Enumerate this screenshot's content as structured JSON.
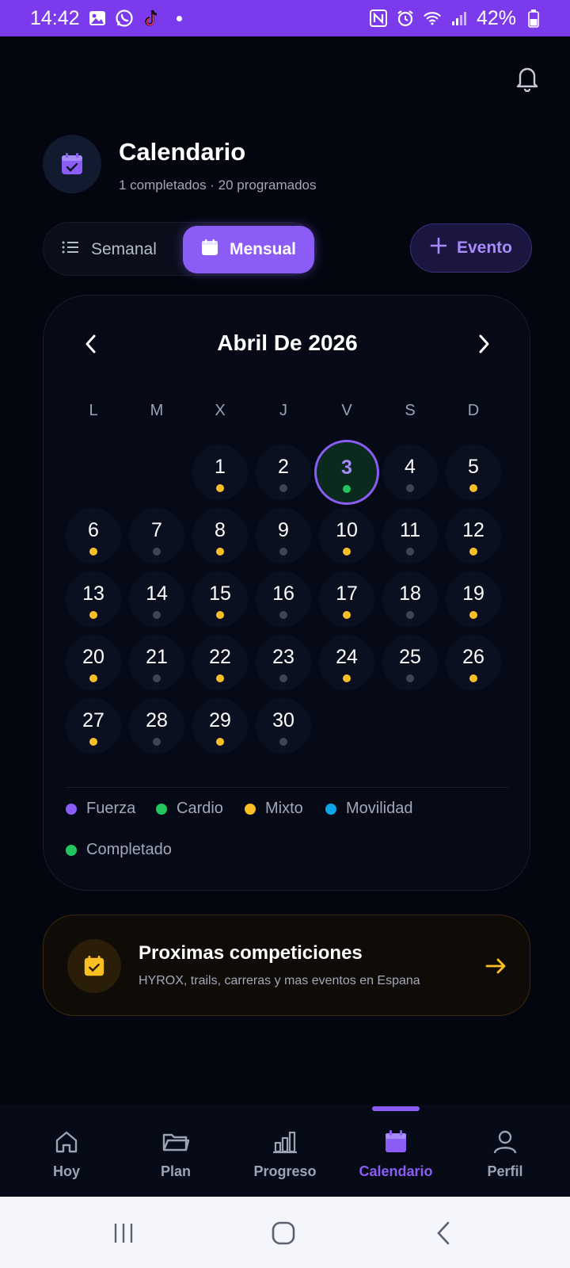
{
  "status_bar": {
    "time": "14:42",
    "battery": "42%",
    "icons_left": [
      "gallery-icon",
      "whatsapp-icon",
      "tiktok-icon",
      "dot-icon"
    ],
    "icons_right": [
      "nfc-icon",
      "alarm-icon",
      "wifi-icon",
      "signal-icon",
      "battery-icon"
    ],
    "bar_color": "#7c3aed"
  },
  "header": {
    "title": "Calendario",
    "subtitle": "1 completados · 20 programados"
  },
  "view_toggle": {
    "weekly_label": "Semanal",
    "monthly_label": "Mensual",
    "selected": "Mensual"
  },
  "add_event": {
    "label": "Evento"
  },
  "calendar": {
    "month_title": "Abril De 2026",
    "weekdays": [
      "L",
      "M",
      "X",
      "J",
      "V",
      "S",
      "D"
    ],
    "first_weekday_index": 2,
    "today": 3,
    "days": [
      {
        "num": "1",
        "dot": "mixto"
      },
      {
        "num": "2",
        "dot": "none"
      },
      {
        "num": "3",
        "dot": "completado"
      },
      {
        "num": "4",
        "dot": "none"
      },
      {
        "num": "5",
        "dot": "mixto"
      },
      {
        "num": "6",
        "dot": "mixto"
      },
      {
        "num": "7",
        "dot": "none"
      },
      {
        "num": "8",
        "dot": "mixto"
      },
      {
        "num": "9",
        "dot": "none"
      },
      {
        "num": "10",
        "dot": "mixto"
      },
      {
        "num": "11",
        "dot": "none"
      },
      {
        "num": "12",
        "dot": "mixto"
      },
      {
        "num": "13",
        "dot": "mixto"
      },
      {
        "num": "14",
        "dot": "none"
      },
      {
        "num": "15",
        "dot": "mixto"
      },
      {
        "num": "16",
        "dot": "none"
      },
      {
        "num": "17",
        "dot": "mixto"
      },
      {
        "num": "18",
        "dot": "none"
      },
      {
        "num": "19",
        "dot": "mixto"
      },
      {
        "num": "20",
        "dot": "mixto"
      },
      {
        "num": "21",
        "dot": "none"
      },
      {
        "num": "22",
        "dot": "mixto"
      },
      {
        "num": "23",
        "dot": "none"
      },
      {
        "num": "24",
        "dot": "mixto"
      },
      {
        "num": "25",
        "dot": "none"
      },
      {
        "num": "26",
        "dot": "mixto"
      },
      {
        "num": "27",
        "dot": "mixto"
      },
      {
        "num": "28",
        "dot": "none"
      },
      {
        "num": "29",
        "dot": "mixto"
      },
      {
        "num": "30",
        "dot": "none"
      }
    ],
    "dot_colors": {
      "fuerza": "#8b5cf6",
      "cardio": "#22c55e",
      "mixto": "#fbbf24",
      "movilidad": "#0ea5e9",
      "completado": "#22c55e",
      "none": "#3f4454"
    },
    "legend": [
      {
        "label": "Fuerza",
        "key": "fuerza"
      },
      {
        "label": "Cardio",
        "key": "cardio"
      },
      {
        "label": "Mixto",
        "key": "mixto"
      },
      {
        "label": "Movilidad",
        "key": "movilidad"
      },
      {
        "label": "Completado",
        "key": "completado"
      }
    ]
  },
  "competitions": {
    "title": "Proximas competiciones",
    "subtitle": "HYROX, trails, carreras y mas eventos en Espana",
    "accent": "#fbbf24"
  },
  "bottom_nav": {
    "items": [
      {
        "label": "Hoy",
        "icon": "home-icon"
      },
      {
        "label": "Plan",
        "icon": "folder-icon"
      },
      {
        "label": "Progreso",
        "icon": "bar-chart-icon"
      },
      {
        "label": "Calendario",
        "icon": "calendar-icon"
      },
      {
        "label": "Perfil",
        "icon": "user-icon"
      }
    ],
    "active": "Calendario",
    "accent": "#8b5cf6"
  }
}
